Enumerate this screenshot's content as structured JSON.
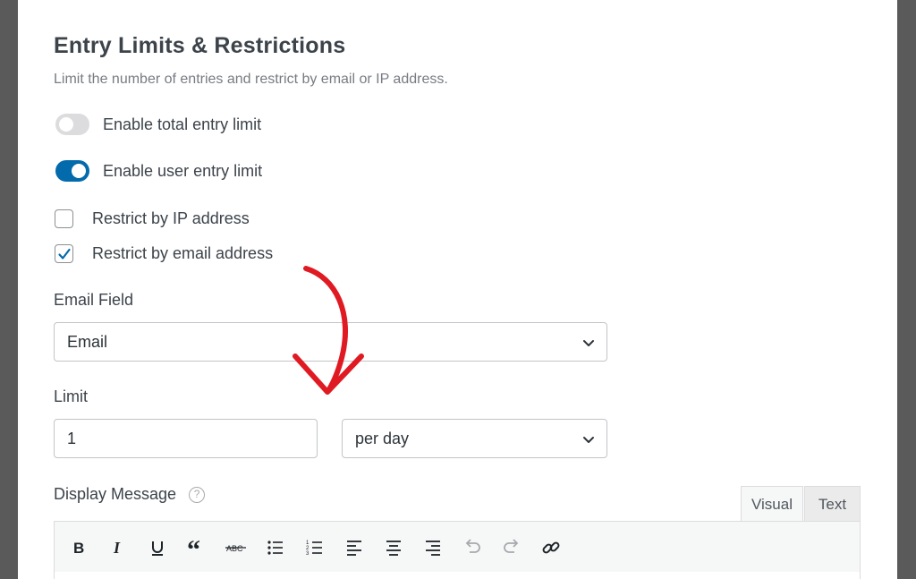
{
  "section": {
    "title": "Entry Limits & Restrictions",
    "description": "Limit the number of entries and restrict by email or IP address."
  },
  "toggles": [
    {
      "label": "Enable total entry limit",
      "on": false
    },
    {
      "label": "Enable user entry limit",
      "on": true
    }
  ],
  "checkboxes": [
    {
      "label": "Restrict by IP address",
      "checked": false
    },
    {
      "label": "Restrict by email address",
      "checked": true
    }
  ],
  "email_field": {
    "label": "Email Field",
    "selected": "Email"
  },
  "limit": {
    "label": "Limit",
    "value": "1",
    "period": "per day"
  },
  "display_message": {
    "label": "Display Message",
    "help_icon": "?",
    "tabs": {
      "visual": "Visual",
      "text": "Text"
    },
    "toolbar_icons": [
      "bold-icon",
      "italic-icon",
      "underline-icon",
      "blockquote-icon",
      "strikethrough-icon",
      "bulleted-list-icon",
      "numbered-list-icon",
      "align-left-icon",
      "align-center-icon",
      "align-right-icon",
      "undo-icon",
      "redo-icon",
      "link-icon"
    ]
  },
  "colors": {
    "toggle_on": "#036aab",
    "toggle_off": "#dcdcde",
    "annotation_arrow": "#e01a22"
  }
}
